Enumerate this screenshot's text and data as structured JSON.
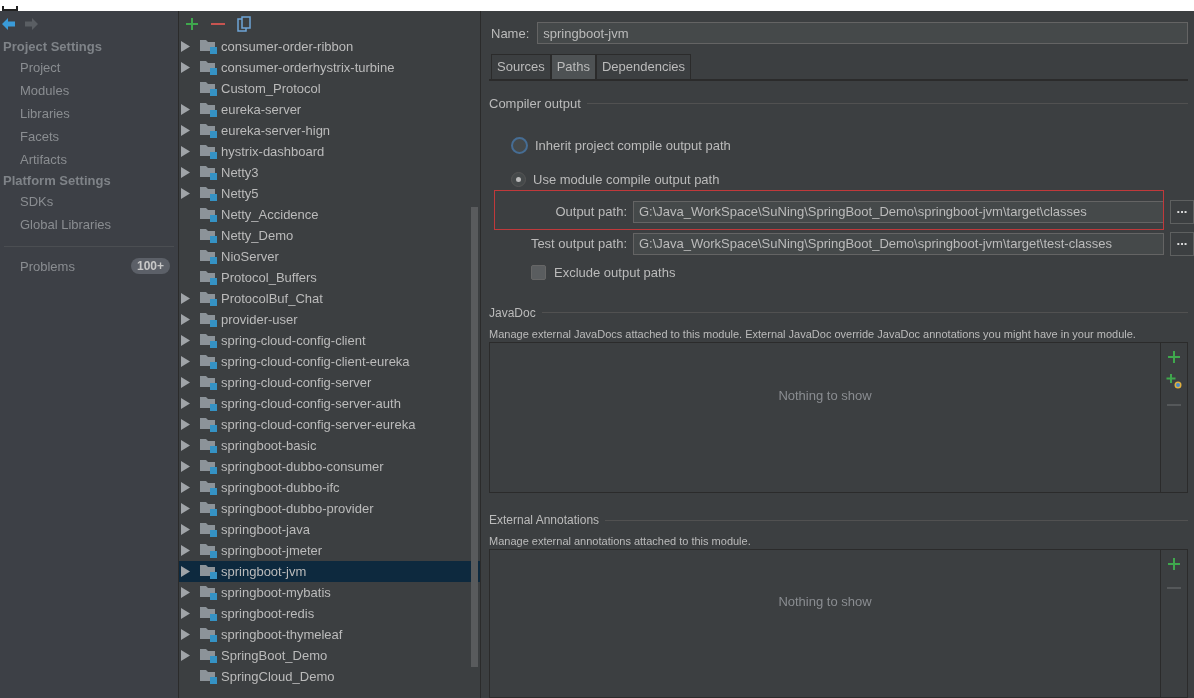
{
  "sidebar": {
    "groups": [
      {
        "title": "Project Settings",
        "items": [
          {
            "label": "Project",
            "selected": false
          },
          {
            "label": "Modules",
            "selected": false
          },
          {
            "label": "Libraries",
            "selected": false
          },
          {
            "label": "Facets",
            "selected": false
          },
          {
            "label": "Artifacts",
            "selected": false
          }
        ]
      },
      {
        "title": "Platform Settings",
        "items": [
          {
            "label": "SDKs",
            "selected": false
          },
          {
            "label": "Global Libraries",
            "selected": false
          }
        ]
      }
    ],
    "problems": {
      "label": "Problems",
      "badge": "100+"
    }
  },
  "modules": [
    {
      "name": "consumer-order-ribbon",
      "expandable": true,
      "selected": false
    },
    {
      "name": "consumer-orderhystrix-turbine",
      "expandable": true,
      "selected": false
    },
    {
      "name": "Custom_Protocol",
      "expandable": false,
      "selected": false
    },
    {
      "name": "eureka-server",
      "expandable": true,
      "selected": false
    },
    {
      "name": "eureka-server-hign",
      "expandable": true,
      "selected": false
    },
    {
      "name": "hystrix-dashboard",
      "expandable": true,
      "selected": false
    },
    {
      "name": "Netty3",
      "expandable": true,
      "selected": false
    },
    {
      "name": "Netty5",
      "expandable": true,
      "selected": false
    },
    {
      "name": "Netty_Accidence",
      "expandable": false,
      "selected": false
    },
    {
      "name": "Netty_Demo",
      "expandable": false,
      "selected": false
    },
    {
      "name": "NioServer",
      "expandable": false,
      "selected": false
    },
    {
      "name": "Protocol_Buffers",
      "expandable": false,
      "selected": false
    },
    {
      "name": "ProtocolBuf_Chat",
      "expandable": true,
      "selected": false
    },
    {
      "name": "provider-user",
      "expandable": true,
      "selected": false
    },
    {
      "name": "spring-cloud-config-client",
      "expandable": true,
      "selected": false
    },
    {
      "name": "spring-cloud-config-client-eureka",
      "expandable": true,
      "selected": false
    },
    {
      "name": "spring-cloud-config-server",
      "expandable": true,
      "selected": false
    },
    {
      "name": "spring-cloud-config-server-auth",
      "expandable": true,
      "selected": false
    },
    {
      "name": "spring-cloud-config-server-eureka",
      "expandable": true,
      "selected": false
    },
    {
      "name": "springboot-basic",
      "expandable": true,
      "selected": false
    },
    {
      "name": "springboot-dubbo-consumer",
      "expandable": true,
      "selected": false
    },
    {
      "name": "springboot-dubbo-ifc",
      "expandable": true,
      "selected": false
    },
    {
      "name": "springboot-dubbo-provider",
      "expandable": true,
      "selected": false
    },
    {
      "name": "springboot-java",
      "expandable": true,
      "selected": false
    },
    {
      "name": "springboot-jmeter",
      "expandable": true,
      "selected": false
    },
    {
      "name": "springboot-jvm",
      "expandable": true,
      "selected": true
    },
    {
      "name": "springboot-mybatis",
      "expandable": true,
      "selected": false
    },
    {
      "name": "springboot-redis",
      "expandable": true,
      "selected": false
    },
    {
      "name": "springboot-thymeleaf",
      "expandable": true,
      "selected": false
    },
    {
      "name": "SpringBoot_Demo",
      "expandable": true,
      "selected": false
    },
    {
      "name": "SpringCloud_Demo",
      "expandable": false,
      "selected": false
    }
  ],
  "details": {
    "name_label": "Name:",
    "name_value": "springboot-jvm",
    "tabs": [
      {
        "label": "Sources",
        "selected": false
      },
      {
        "label": "Paths",
        "selected": true
      },
      {
        "label": "Dependencies",
        "selected": false
      }
    ],
    "compiler_output": {
      "title": "Compiler output",
      "options": [
        {
          "label": "Inherit project compile output path",
          "selected": false
        },
        {
          "label": "Use module compile output path",
          "selected": true
        }
      ],
      "paths": [
        {
          "label": "Output path:",
          "value": "G:\\Java_WorkSpace\\SuNing\\SpringBoot_Demo\\springboot-jvm\\target\\classes",
          "highlighted": true,
          "button": "..."
        },
        {
          "label": "Test output path:",
          "value": "G:\\Java_WorkSpace\\SuNing\\SpringBoot_Demo\\springboot-jvm\\target\\test-classes",
          "highlighted": false,
          "button": "..."
        }
      ],
      "exclude": {
        "label": "Exclude output paths",
        "checked": false
      }
    },
    "sections": [
      {
        "title": "JavaDoc",
        "description": "Manage external JavaDocs attached to this module. External JavaDoc override JavaDoc annotations you might have in your module.",
        "empty_text": "Nothing to show",
        "tools": [
          {
            "kind": "add"
          },
          {
            "kind": "add-url"
          },
          {
            "kind": "remove"
          }
        ]
      },
      {
        "title": "External Annotations",
        "description": "Manage external annotations attached to this module.",
        "empty_text": "Nothing to show",
        "tools": [
          {
            "kind": "add"
          },
          {
            "kind": "remove"
          }
        ]
      }
    ]
  }
}
